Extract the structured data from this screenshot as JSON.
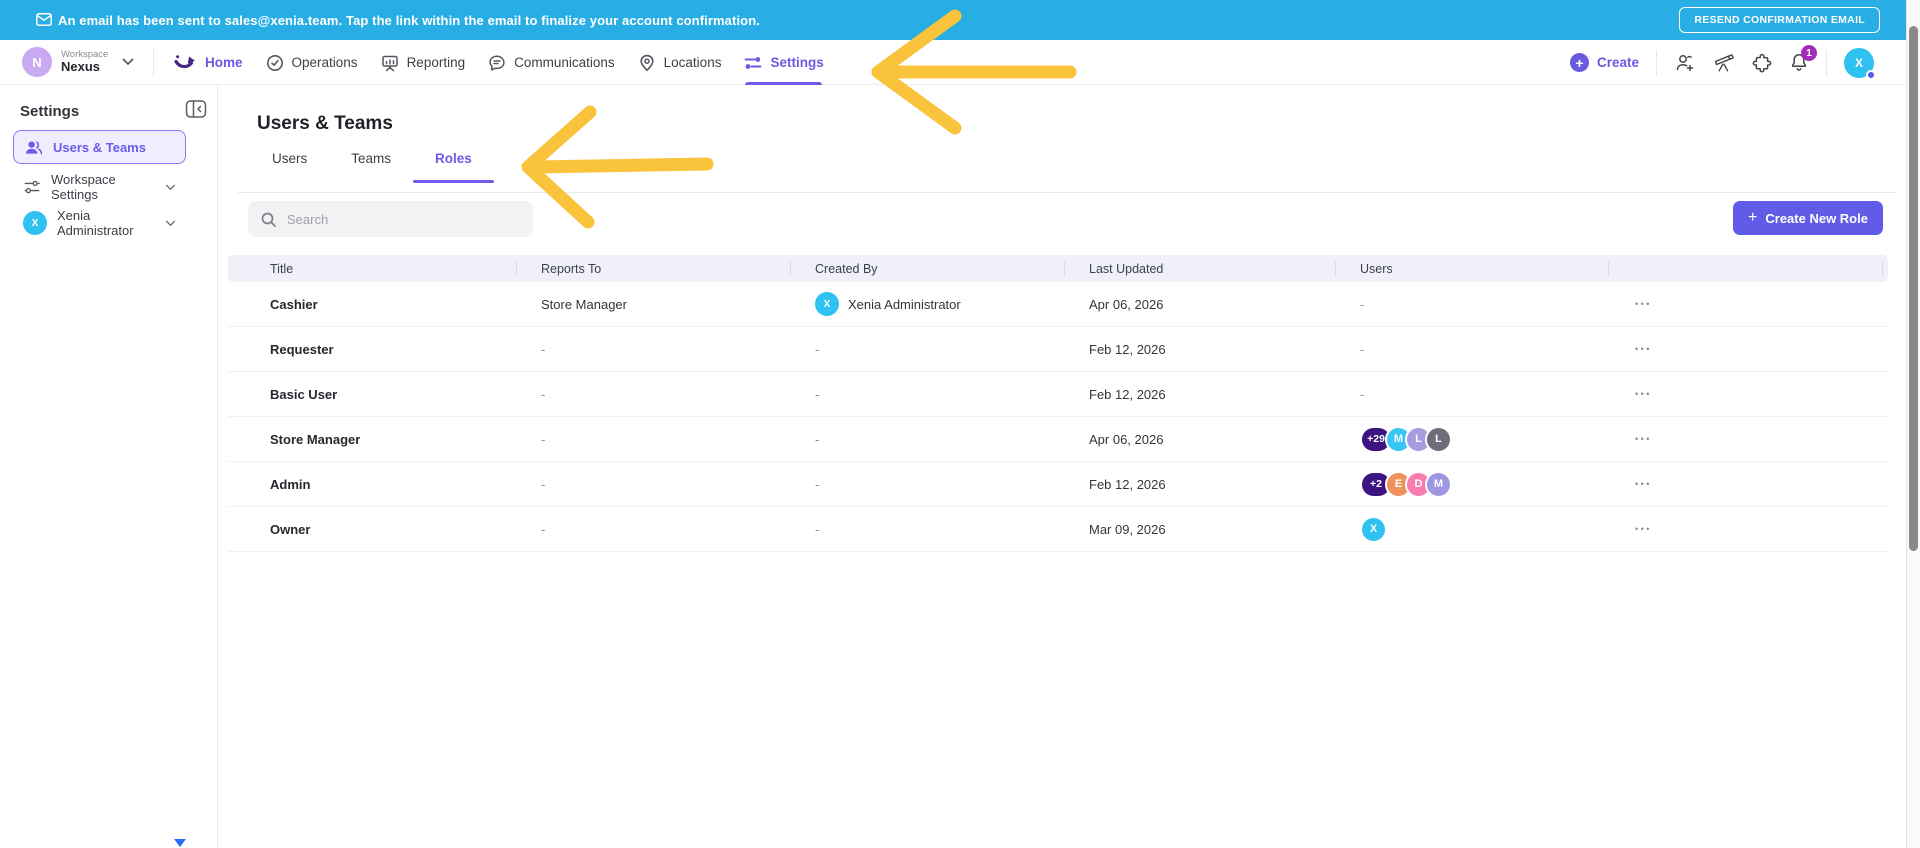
{
  "banner": {
    "message": "An email has been sent to sales@xenia.team. Tap the link within the email to finalize your account confirmation.",
    "resend_button_label": "RESEND CONFIRMATION EMAIL"
  },
  "navbar": {
    "workspace_label": "Workspace",
    "workspace_name": "Nexus",
    "workspace_avatar_initial": "N",
    "items": [
      {
        "label": "Home",
        "active": true
      },
      {
        "label": "Operations",
        "active": false
      },
      {
        "label": "Reporting",
        "active": false
      },
      {
        "label": "Communications",
        "active": false
      },
      {
        "label": "Locations",
        "active": false
      },
      {
        "label": "Settings",
        "active": true
      }
    ],
    "create_label": "Create",
    "notification_badge": "1",
    "user_avatar_initial": "X"
  },
  "sidebar": {
    "title": "Settings",
    "items": [
      {
        "label": "Users & Teams",
        "active": true
      },
      {
        "label": "Workspace Settings",
        "active": false
      },
      {
        "label": "Xenia Administrator",
        "active": false,
        "avatar_initial": "X",
        "avatar_color": "#2FC1F0"
      }
    ]
  },
  "main": {
    "title": "Users & Teams",
    "tabs": [
      {
        "label": "Users",
        "active": false
      },
      {
        "label": "Teams",
        "active": false
      },
      {
        "label": "Roles",
        "active": true
      }
    ],
    "search_placeholder": "Search",
    "create_button_label": "Create New Role",
    "table": {
      "columns": [
        "Title",
        "Reports To",
        "Created By",
        "Last Updated",
        "Users",
        ""
      ],
      "empty_value": "-",
      "rows": [
        {
          "title": "Cashier",
          "reports_to": "Store Manager",
          "created_by": {
            "name": "Xenia Administrator",
            "initial": "X",
            "color": "#2FC1F0"
          },
          "last_updated": "Apr 06, 2026",
          "users": []
        },
        {
          "title": "Requester",
          "reports_to": "-",
          "created_by": "-",
          "last_updated": "Feb 12, 2026",
          "users": []
        },
        {
          "title": "Basic User",
          "reports_to": "-",
          "created_by": "-",
          "last_updated": "Feb 12, 2026",
          "users": []
        },
        {
          "title": "Store Manager",
          "reports_to": "-",
          "created_by": "-",
          "last_updated": "Apr 06, 2026",
          "users": [
            {
              "text": "+29",
              "color": "#3D1580"
            },
            {
              "text": "M",
              "color": "#38C6F4"
            },
            {
              "text": "L",
              "color": "#A79BE1"
            },
            {
              "text": "L",
              "color": "#6E6D79"
            }
          ]
        },
        {
          "title": "Admin",
          "reports_to": "-",
          "created_by": "-",
          "last_updated": "Feb 12, 2026",
          "users": [
            {
              "text": "+2",
              "color": "#3D1580"
            },
            {
              "text": "E",
              "color": "#F0915B"
            },
            {
              "text": "D",
              "color": "#F97CB1"
            },
            {
              "text": "M",
              "color": "#9D97E2"
            }
          ]
        },
        {
          "title": "Owner",
          "reports_to": "-",
          "created_by": "-",
          "last_updated": "Mar 09, 2026",
          "users": [
            {
              "text": "X",
              "color": "#2FC1F0"
            }
          ]
        }
      ]
    }
  },
  "icons": {
    "plus": "+",
    "ellipsis": "•••"
  },
  "colors": {
    "banner_bg": "#28AEE4",
    "accent_purple": "#6C5CE7",
    "create_button_bg": "#615CE8",
    "annotation_arrow": "#F9C43C",
    "notification_badge_bg": "#A52CB8",
    "table_header_bg": "#EFF0F8",
    "user_avatar_cyan": "#2FC1F0",
    "workspace_avatar_bg": "#C9A9F2"
  }
}
